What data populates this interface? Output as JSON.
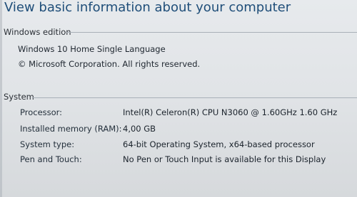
{
  "page": {
    "title": "View basic information about your computer"
  },
  "windows_edition": {
    "header": "Windows edition",
    "edition_name": "Windows 10 Home Single Language",
    "copyright": "© Microsoft Corporation. All rights reserved."
  },
  "system": {
    "header": "System",
    "rows": [
      {
        "label": "Processor:",
        "value": "Intel(R) Celeron(R) CPU  N3060  @ 1.60GHz   1.60 GHz"
      },
      {
        "label": "Installed memory (RAM):",
        "value": "4,00 GB"
      },
      {
        "label": "System type:",
        "value": "64-bit Operating System, x64-based processor"
      },
      {
        "label": "Pen and Touch:",
        "value": "No Pen or Touch Input is available for this Display"
      }
    ]
  },
  "colors": {
    "title": "#1f4e79",
    "background": "#e1e4e7",
    "rule": "#a8b0b8"
  }
}
